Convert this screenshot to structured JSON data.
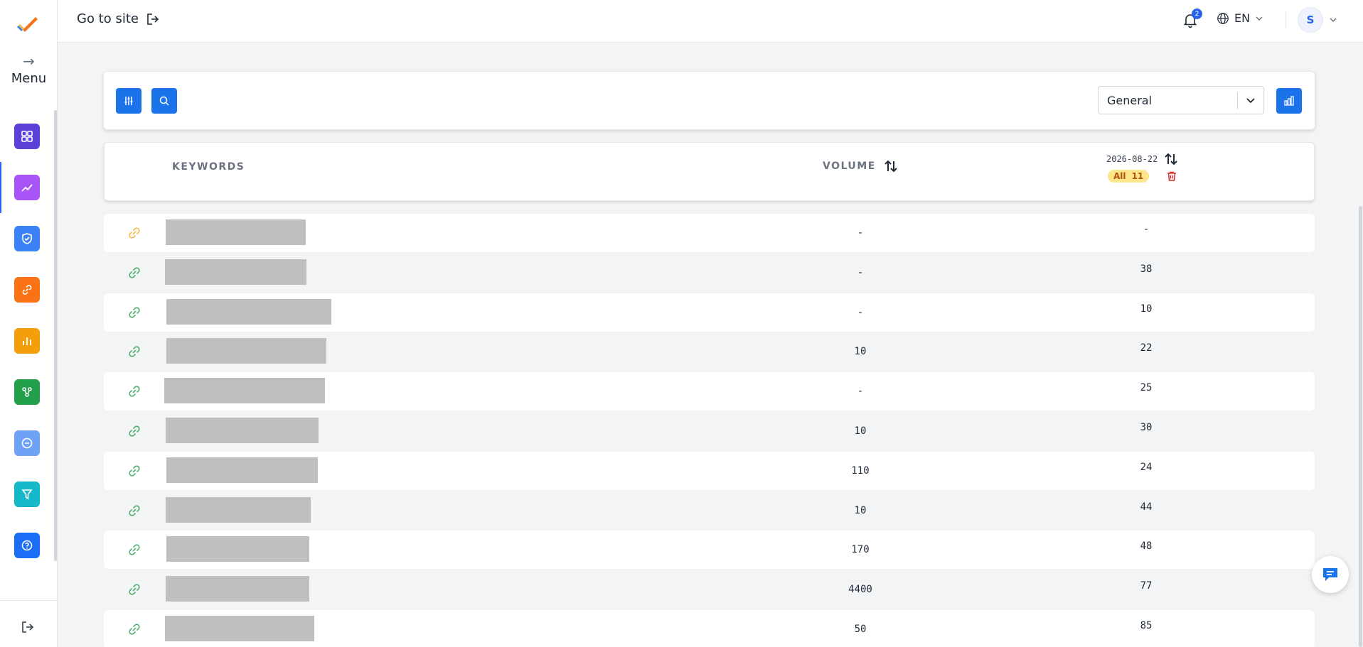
{
  "sidebar": {
    "menu_label": "Menu",
    "menu_arrow": "→",
    "nav_items": [
      {
        "name": "dashboard",
        "icon": "grid-icon",
        "color": "#5b3fd6"
      },
      {
        "name": "rank-tracker",
        "icon": "trend-icon",
        "color": "#a855f7"
      },
      {
        "name": "site-audit",
        "icon": "shield-check-icon",
        "color": "#3b82f6"
      },
      {
        "name": "backlinks",
        "icon": "link-icon",
        "color": "#f97316"
      },
      {
        "name": "analytics",
        "icon": "bar-chart-icon",
        "color": "#f59e0b"
      },
      {
        "name": "network",
        "icon": "share-icon",
        "color": "#22a04b"
      },
      {
        "name": "blocked",
        "icon": "minus-circle-icon",
        "color": "#6ea2f5"
      },
      {
        "name": "filters",
        "icon": "funnel-icon",
        "color": "#14b8c8"
      },
      {
        "name": "help",
        "icon": "question-icon",
        "color": "#1a6ef5"
      }
    ]
  },
  "topbar": {
    "goto_site": "Go to site",
    "notification_count": "2",
    "language": "EN",
    "avatar_initial": "S"
  },
  "filters": {
    "select_value": "General"
  },
  "table": {
    "col_keywords": "KEYWORDS",
    "col_volume": "VOLUME",
    "col_date": "2026-08-22",
    "badge_all": "All",
    "badge_count": "11",
    "rows": [
      {
        "volume": "-",
        "rank": "-",
        "link_color": "#f5b84a"
      },
      {
        "volume": "-",
        "rank": "38",
        "link_color": "#4caf6a"
      },
      {
        "volume": "-",
        "rank": "10",
        "link_color": "#4caf6a"
      },
      {
        "volume": "10",
        "rank": "22",
        "link_color": "#4caf6a"
      },
      {
        "volume": "-",
        "rank": "25",
        "link_color": "#4caf6a"
      },
      {
        "volume": "10",
        "rank": "30",
        "link_color": "#4caf6a"
      },
      {
        "volume": "110",
        "rank": "24",
        "link_color": "#4caf6a"
      },
      {
        "volume": "10",
        "rank": "44",
        "link_color": "#4caf6a"
      },
      {
        "volume": "170",
        "rank": "48",
        "link_color": "#4caf6a"
      },
      {
        "volume": "4400",
        "rank": "77",
        "link_color": "#4caf6a"
      },
      {
        "volume": "50",
        "rank": "85",
        "link_color": "#4caf6a"
      }
    ]
  },
  "colors": {
    "primary": "#1a73e8",
    "trash": "#dc2626",
    "badge_bg": "#fde68a"
  }
}
